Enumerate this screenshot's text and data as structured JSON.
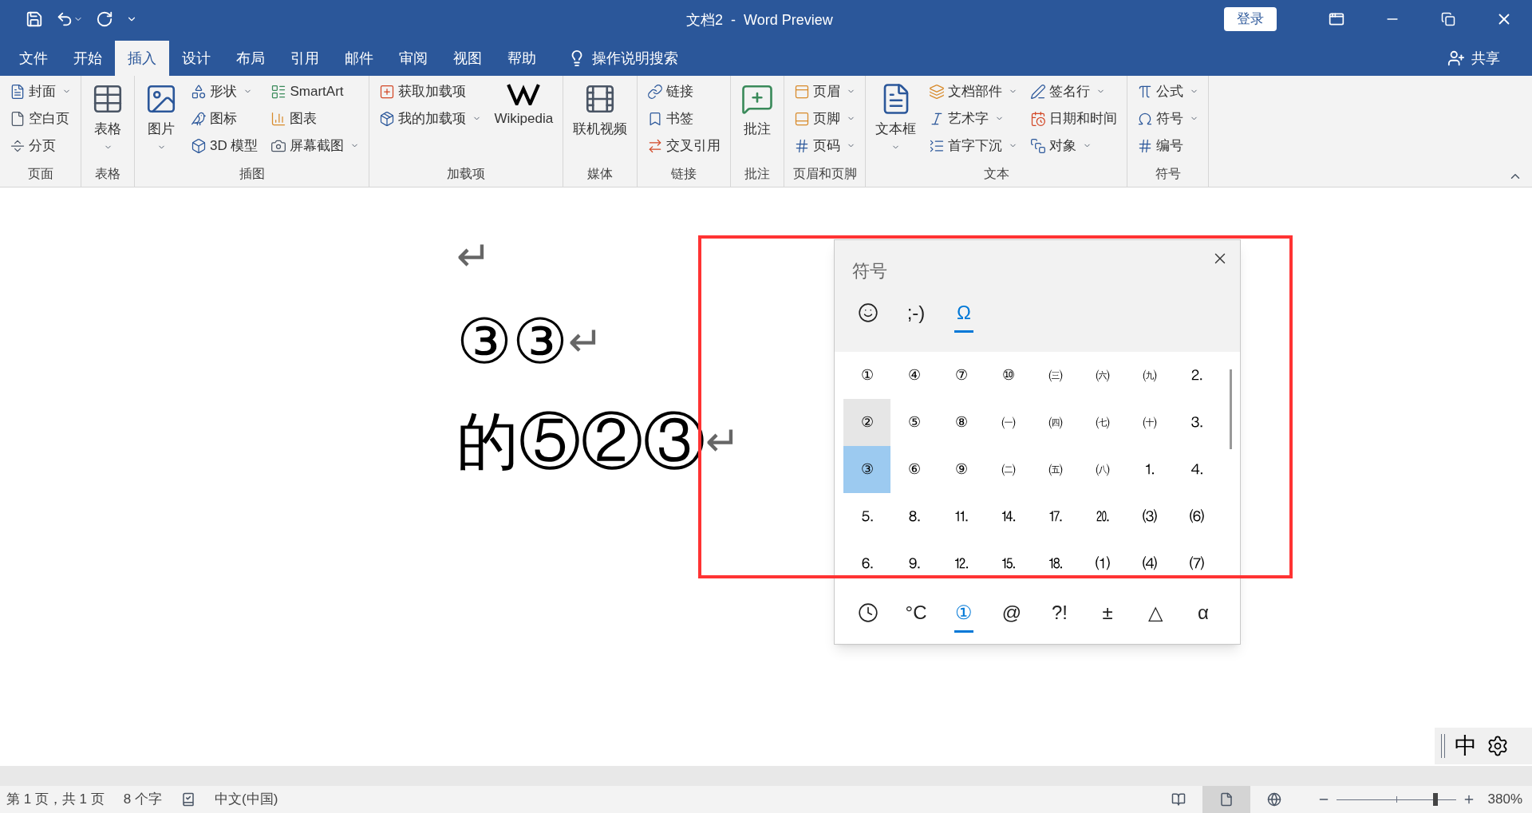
{
  "window": {
    "title": "文档2  -  Word Preview",
    "login": "登录"
  },
  "tabs": [
    {
      "label": "文件",
      "selected": false
    },
    {
      "label": "开始",
      "selected": false
    },
    {
      "label": "插入",
      "selected": true
    },
    {
      "label": "设计",
      "selected": false
    },
    {
      "label": "布局",
      "selected": false
    },
    {
      "label": "引用",
      "selected": false
    },
    {
      "label": "邮件",
      "selected": false
    },
    {
      "label": "审阅",
      "selected": false
    },
    {
      "label": "视图",
      "selected": false
    },
    {
      "label": "帮助",
      "selected": false
    }
  ],
  "tell_me": "操作说明搜索",
  "share": "共享",
  "ribbon": {
    "groups": [
      {
        "label": "页面",
        "columns": [
          {
            "kind": "stack",
            "items": [
              {
                "label": "封面",
                "dropdown": true
              },
              {
                "label": "空白页",
                "dropdown": false
              },
              {
                "label": "分页",
                "dropdown": false
              }
            ]
          }
        ]
      },
      {
        "label": "表格",
        "columns": [
          {
            "kind": "large",
            "label": "表格",
            "dropdown": true
          }
        ]
      },
      {
        "label": "插图",
        "columns": [
          {
            "kind": "large",
            "label": "图片",
            "dropdown": true
          },
          {
            "kind": "stack",
            "items": [
              {
                "label": "形状",
                "dropdown": true
              },
              {
                "label": "图标",
                "dropdown": false
              },
              {
                "label": "3D 模型",
                "dropdown": false
              }
            ]
          },
          {
            "kind": "stack",
            "items": [
              {
                "label": "SmartArt",
                "dropdown": false
              },
              {
                "label": "图表",
                "dropdown": false
              },
              {
                "label": "屏幕截图",
                "dropdown": true
              }
            ]
          }
        ]
      },
      {
        "label": "加载项",
        "columns": [
          {
            "kind": "stack",
            "items": [
              {
                "label": "获取加载项",
                "dropdown": false
              },
              {
                "label": "我的加载项",
                "dropdown": true
              }
            ]
          },
          {
            "kind": "large",
            "label": "Wikipedia",
            "dropdown": false
          }
        ]
      },
      {
        "label": "媒体",
        "columns": [
          {
            "kind": "large",
            "label": "联机视频",
            "dropdown": false
          }
        ]
      },
      {
        "label": "链接",
        "columns": [
          {
            "kind": "stack",
            "items": [
              {
                "label": "链接",
                "dropdown": false
              },
              {
                "label": "书签",
                "dropdown": false
              },
              {
                "label": "交叉引用",
                "dropdown": false
              }
            ]
          }
        ]
      },
      {
        "label": "批注",
        "columns": [
          {
            "kind": "large",
            "label": "批注",
            "dropdown": false
          }
        ]
      },
      {
        "label": "页眉和页脚",
        "columns": [
          {
            "kind": "stack",
            "items": [
              {
                "label": "页眉",
                "dropdown": true
              },
              {
                "label": "页脚",
                "dropdown": true
              },
              {
                "label": "页码",
                "dropdown": true
              }
            ]
          }
        ]
      },
      {
        "label": "文本",
        "columns": [
          {
            "kind": "large",
            "label": "文本框",
            "dropdown": true
          },
          {
            "kind": "stack",
            "items": [
              {
                "label": "文档部件",
                "dropdown": true
              },
              {
                "label": "艺术字",
                "dropdown": true
              },
              {
                "label": "首字下沉",
                "dropdown": true
              }
            ]
          },
          {
            "kind": "stack",
            "items": [
              {
                "label": "签名行",
                "dropdown": true
              },
              {
                "label": "日期和时间",
                "dropdown": false
              },
              {
                "label": "对象",
                "dropdown": true
              }
            ]
          }
        ]
      },
      {
        "label": "符号",
        "columns": [
          {
            "kind": "stack",
            "items": [
              {
                "label": "公式",
                "dropdown": true
              },
              {
                "label": "符号",
                "dropdown": true
              },
              {
                "label": "编号",
                "dropdown": false
              }
            ]
          }
        ]
      }
    ]
  },
  "document": {
    "paragraphs": [
      {
        "mark": "↵"
      },
      {
        "text": "③③",
        "mark": "↵"
      },
      {
        "text": "的⑤②③",
        "mark": "↵"
      }
    ]
  },
  "symbol_panel": {
    "title": "符号",
    "categories": [
      {
        "kind": "emoji",
        "selected": false
      },
      {
        "kind": "text",
        "label": ";-)",
        "selected": false
      },
      {
        "kind": "text",
        "label": "Ω",
        "selected": true
      }
    ],
    "grid": [
      {
        "symbol": "①",
        "hovered": false,
        "selected": false
      },
      {
        "symbol": "④",
        "hovered": false,
        "selected": false
      },
      {
        "symbol": "⑦",
        "hovered": false,
        "selected": false
      },
      {
        "symbol": "⑩",
        "hovered": false,
        "selected": false
      },
      {
        "symbol": "㈢",
        "hovered": false,
        "selected": false
      },
      {
        "symbol": "㈥",
        "hovered": false,
        "selected": false
      },
      {
        "symbol": "㈨",
        "hovered": false,
        "selected": false
      },
      {
        "symbol": "⒉",
        "hovered": false,
        "selected": false
      },
      {
        "symbol": "②",
        "hovered": true,
        "selected": false
      },
      {
        "symbol": "⑤",
        "hovered": false,
        "selected": false
      },
      {
        "symbol": "⑧",
        "hovered": false,
        "selected": false
      },
      {
        "symbol": "㈠",
        "hovered": false,
        "selected": false
      },
      {
        "symbol": "㈣",
        "hovered": false,
        "selected": false
      },
      {
        "symbol": "㈦",
        "hovered": false,
        "selected": false
      },
      {
        "symbol": "㈩",
        "hovered": false,
        "selected": false
      },
      {
        "symbol": "⒊",
        "hovered": false,
        "selected": false
      },
      {
        "symbol": "③",
        "hovered": false,
        "selected": true
      },
      {
        "symbol": "⑥",
        "hovered": false,
        "selected": false
      },
      {
        "symbol": "⑨",
        "hovered": false,
        "selected": false
      },
      {
        "symbol": "㈡",
        "hovered": false,
        "selected": false
      },
      {
        "symbol": "㈤",
        "hovered": false,
        "selected": false
      },
      {
        "symbol": "㈧",
        "hovered": false,
        "selected": false
      },
      {
        "symbol": "⒈",
        "hovered": false,
        "selected": false
      },
      {
        "symbol": "⒋",
        "hovered": false,
        "selected": false
      },
      {
        "symbol": "⒌",
        "hovered": false,
        "selected": false
      },
      {
        "symbol": "⒏",
        "hovered": false,
        "selected": false
      },
      {
        "symbol": "⒒",
        "hovered": false,
        "selected": false
      },
      {
        "symbol": "⒕",
        "hovered": false,
        "selected": false
      },
      {
        "symbol": "⒘",
        "hovered": false,
        "selected": false
      },
      {
        "symbol": "⒛",
        "hovered": false,
        "selected": false
      },
      {
        "symbol": "⑶",
        "hovered": false,
        "selected": false
      },
      {
        "symbol": "⑹",
        "hovered": false,
        "selected": false
      },
      {
        "symbol": "⒍",
        "hovered": false,
        "selected": false
      },
      {
        "symbol": "⒐",
        "hovered": false,
        "selected": false
      },
      {
        "symbol": "⒓",
        "hovered": false,
        "selected": false
      },
      {
        "symbol": "⒖",
        "hovered": false,
        "selected": false
      },
      {
        "symbol": "⒙",
        "hovered": false,
        "selected": false
      },
      {
        "symbol": "⑴",
        "hovered": false,
        "selected": false
      },
      {
        "symbol": "⑷",
        "hovered": false,
        "selected": false
      },
      {
        "symbol": "⑺",
        "hovered": false,
        "selected": false
      }
    ],
    "subcategories": [
      {
        "kind": "clock",
        "selected": false
      },
      {
        "kind": "text",
        "label": "°C",
        "selected": false
      },
      {
        "kind": "text",
        "label": "①",
        "selected": true
      },
      {
        "kind": "text",
        "label": "@",
        "selected": false
      },
      {
        "kind": "text",
        "label": "?!",
        "selected": false
      },
      {
        "kind": "text",
        "label": "±",
        "selected": false
      },
      {
        "kind": "text",
        "label": "△",
        "selected": false
      },
      {
        "kind": "text",
        "label": "α",
        "selected": false
      }
    ]
  },
  "ime": {
    "mode": "中"
  },
  "status_bar": {
    "page": "第 1 页，共 1 页",
    "words": "8 个字",
    "language": "中文(中国)",
    "views": [
      {
        "selected": false
      },
      {
        "selected": true
      },
      {
        "selected": false
      }
    ],
    "zoom": {
      "level": 0.83,
      "reading": "380%"
    }
  }
}
